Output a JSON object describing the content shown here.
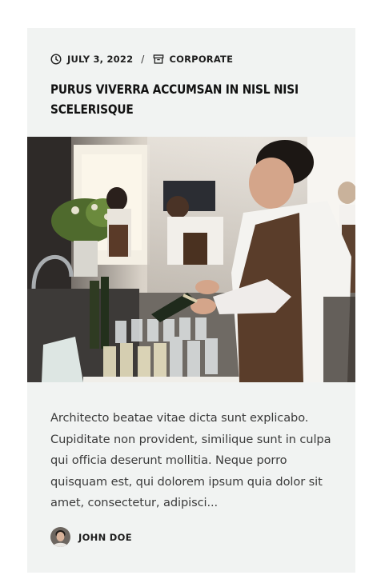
{
  "post": {
    "date": "JULY 3, 2022",
    "separator": "/",
    "category": "CORPORATE",
    "title": "PURUS VIVERRA ACCUMSAN IN NISL NISI SCELERISQUE",
    "excerpt": "Architecto beatae vitae dicta sunt explicabo. Cupiditate non provident, similique sunt in culpa qui officia deserunt mollitia. Neque porro quisquam est, qui dolorem ipsum quia dolor sit amet, consectetur, adipisci...",
    "author": "JOHN DOE"
  },
  "icons": {
    "date": "clock-icon",
    "category": "archive-box-icon"
  },
  "colors": {
    "card_background": "#f1f3f2",
    "text": "#1e1e1e"
  }
}
